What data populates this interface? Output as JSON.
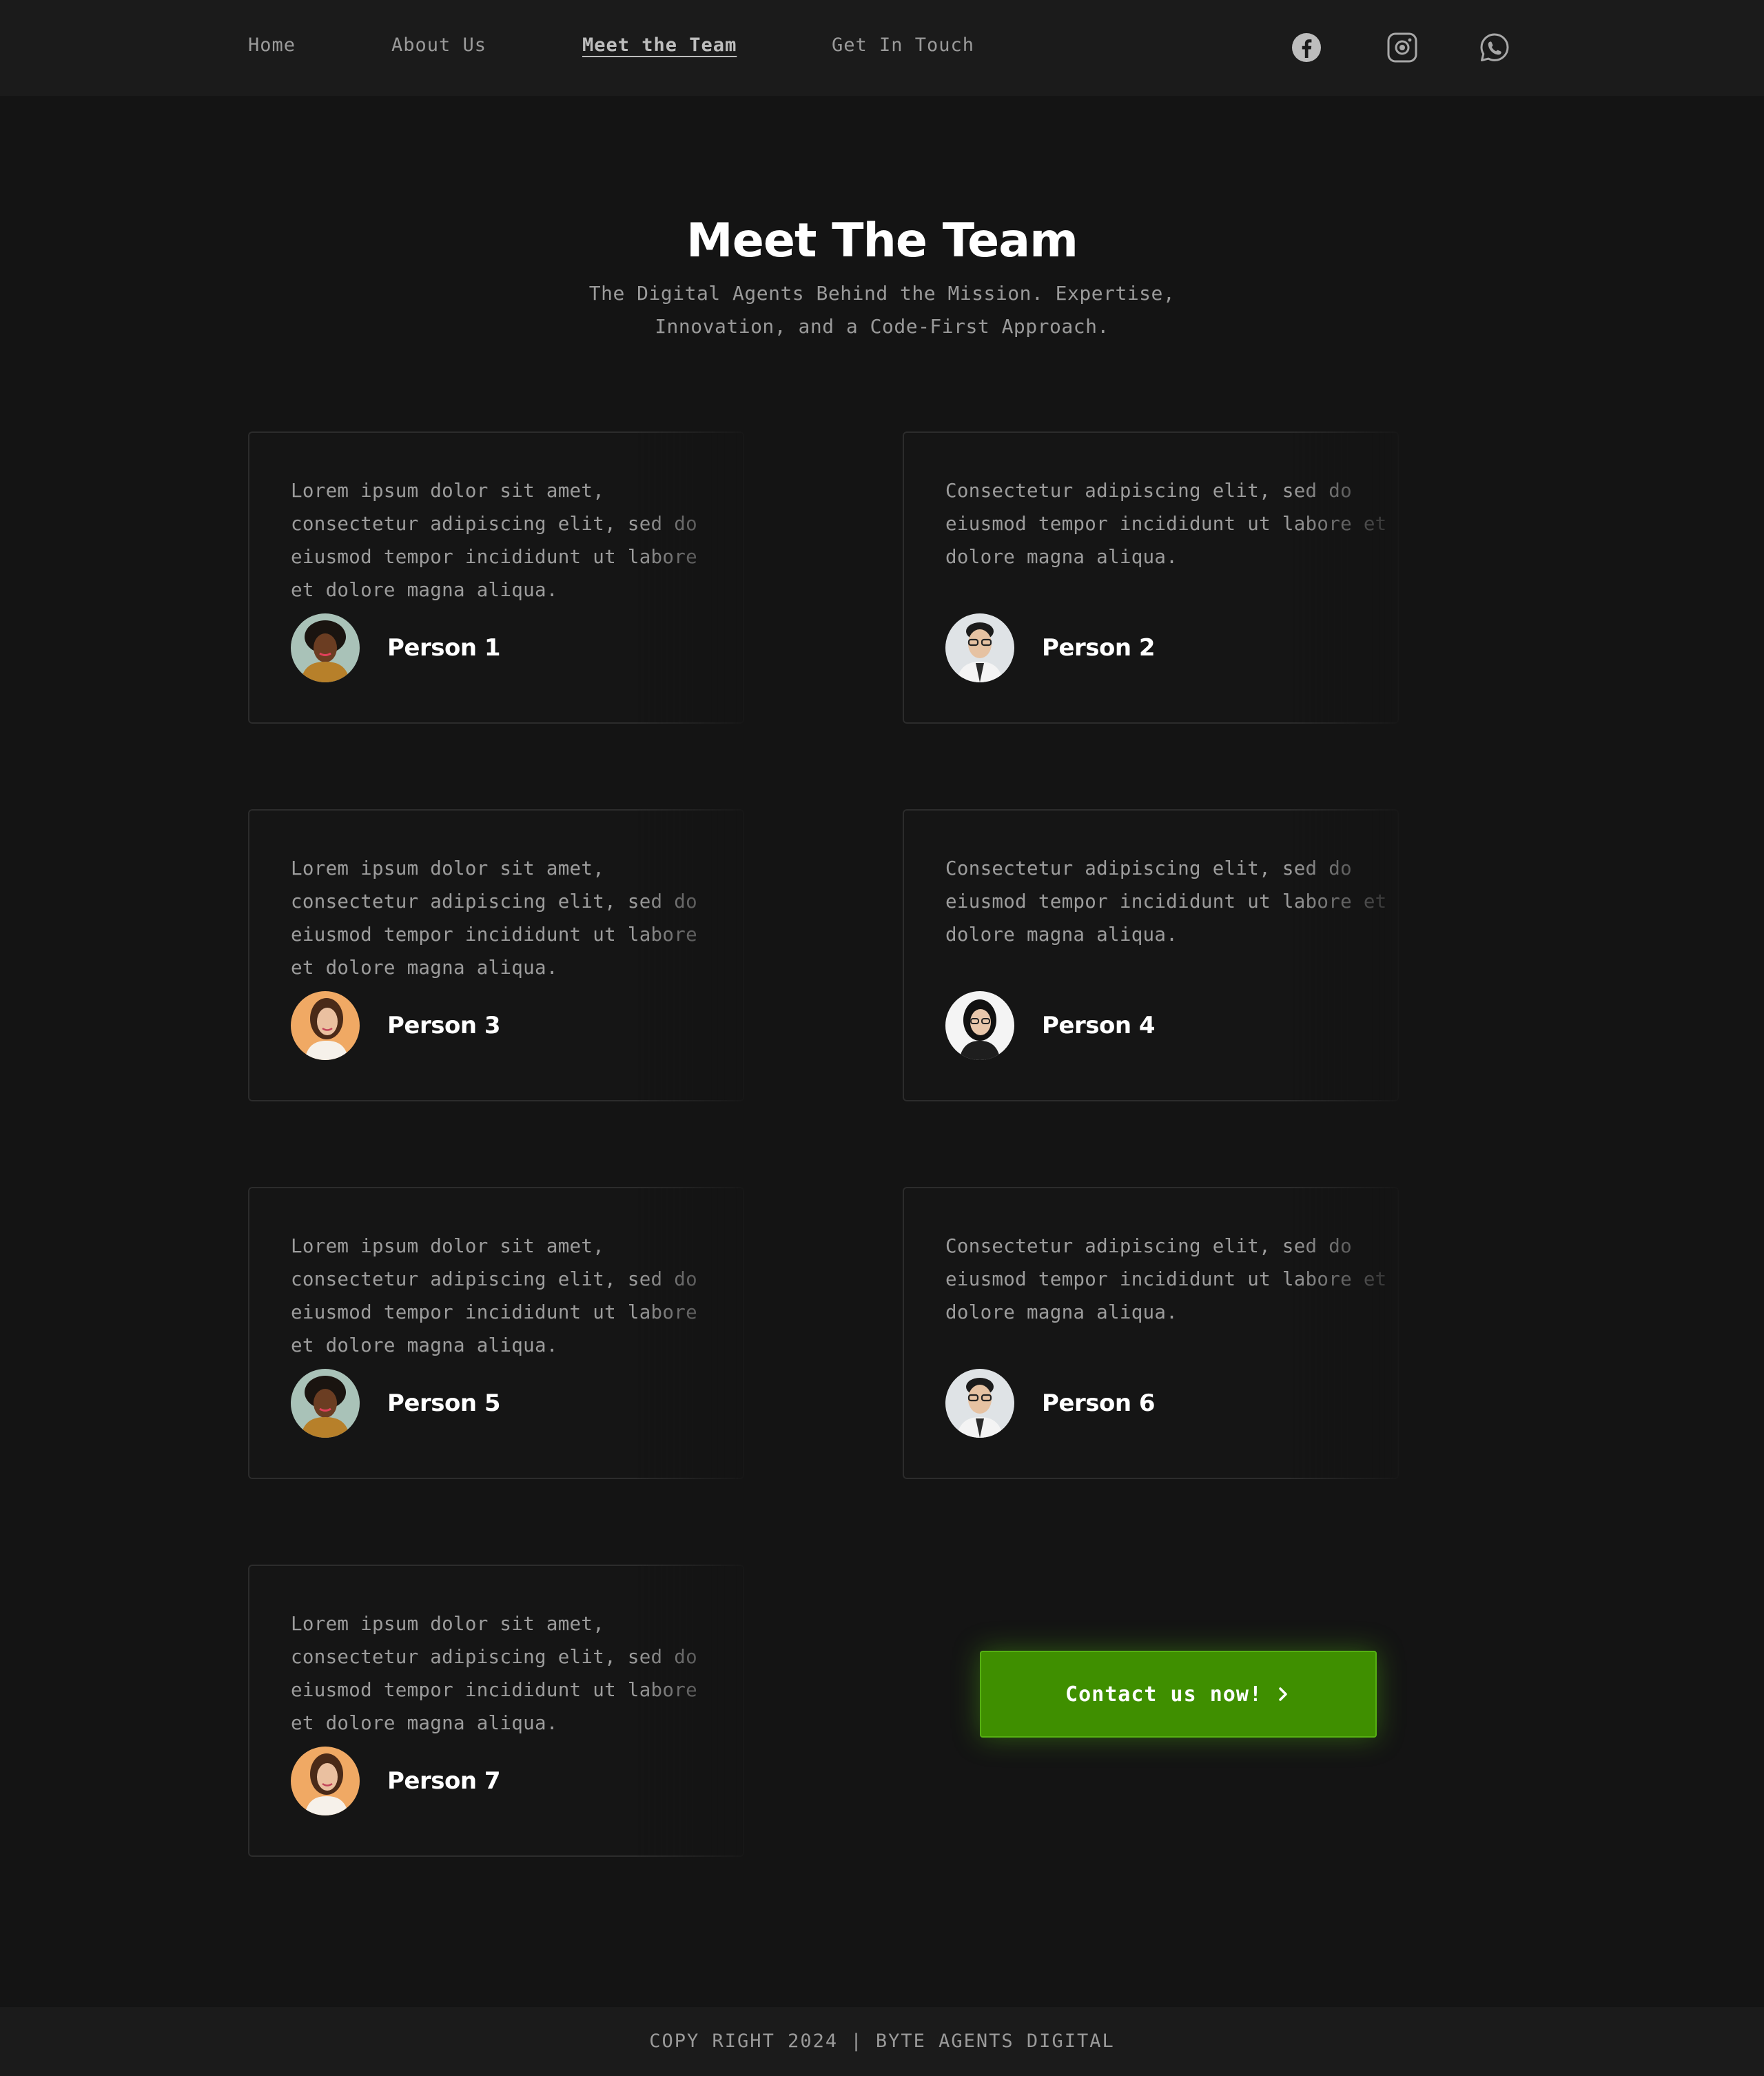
{
  "nav": {
    "items": [
      {
        "label": "Home",
        "active": false
      },
      {
        "label": "About Us",
        "active": false
      },
      {
        "label": "Meet the Team",
        "active": true
      },
      {
        "label": "Get In Touch",
        "active": false
      }
    ],
    "social_icons": [
      "facebook-icon",
      "instagram-icon",
      "whatsapp-icon"
    ]
  },
  "hero": {
    "title": "Meet The Team",
    "subtitle": "The Digital Agents Behind the Mission. Expertise, Innovation, and a Code-First Approach."
  },
  "team": [
    {
      "quote": "Lorem ipsum dolor sit amet, consectetur adipiscing elit, sed do eiusmod tempor incididunt ut labore et dolore magna aliqua.",
      "name": "Person 1",
      "avatar": "avatar-a"
    },
    {
      "quote": "Consectetur adipiscing elit, sed do eiusmod tempor incididunt ut labore et dolore magna aliqua.",
      "name": "Person 2",
      "avatar": "avatar-b"
    },
    {
      "quote": "Lorem ipsum dolor sit amet, consectetur adipiscing elit, sed do eiusmod tempor incididunt ut labore et dolore magna aliqua.",
      "name": "Person 3",
      "avatar": "avatar-c"
    },
    {
      "quote": "Consectetur adipiscing elit, sed do eiusmod tempor incididunt ut labore et dolore magna aliqua.",
      "name": "Person 4",
      "avatar": "avatar-d"
    },
    {
      "quote": "Lorem ipsum dolor sit amet, consectetur adipiscing elit, sed do eiusmod tempor incididunt ut labore et dolore magna aliqua.",
      "name": "Person 5",
      "avatar": "avatar-a"
    },
    {
      "quote": "Consectetur adipiscing elit, sed do eiusmod tempor incididunt ut labore et dolore magna aliqua.",
      "name": "Person 6",
      "avatar": "avatar-b"
    },
    {
      "quote": "Lorem ipsum dolor sit amet, consectetur adipiscing elit, sed do eiusmod tempor incididunt ut labore et dolore magna aliqua.",
      "name": "Person 7",
      "avatar": "avatar-c"
    }
  ],
  "cta": {
    "label": "Contact us now!"
  },
  "footer": {
    "text": "COPY RIGHT 2024 | BYTE AGENTS DIGITAL"
  },
  "colors": {
    "background": "#141414",
    "header": "#1b1b1b",
    "accent": "#3f8f00",
    "text_muted": "#9a9a9a",
    "heading": "#ffffff"
  }
}
